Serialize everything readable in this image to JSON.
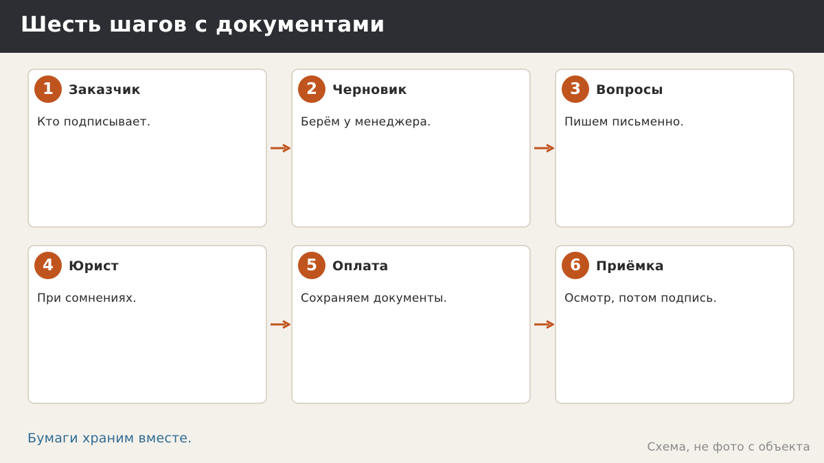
{
  "header": {
    "title": "Шесть шагов с документами"
  },
  "steps": [
    {
      "number": "1",
      "title": "Заказчик",
      "text": "Кто подписывает."
    },
    {
      "number": "2",
      "title": "Черновик",
      "text": "Берём у менеджера."
    },
    {
      "number": "3",
      "title": "Вопросы",
      "text": "Пишем письменно."
    },
    {
      "number": "4",
      "title": "Юрист",
      "text": "При сомнениях."
    },
    {
      "number": "5",
      "title": "Оплата",
      "text": "Сохраняем документы."
    },
    {
      "number": "6",
      "title": "Приёмка",
      "text": "Осмотр, потом подпись."
    }
  ],
  "footer": {
    "note": "Бумаги храним вместе.",
    "caption": "Схема, не фото с объекта"
  },
  "colors": {
    "header_bg": "#2c2e33",
    "accent": "#c0541e",
    "note": "#2f6b93",
    "page_bg": "#f4f1eb"
  }
}
